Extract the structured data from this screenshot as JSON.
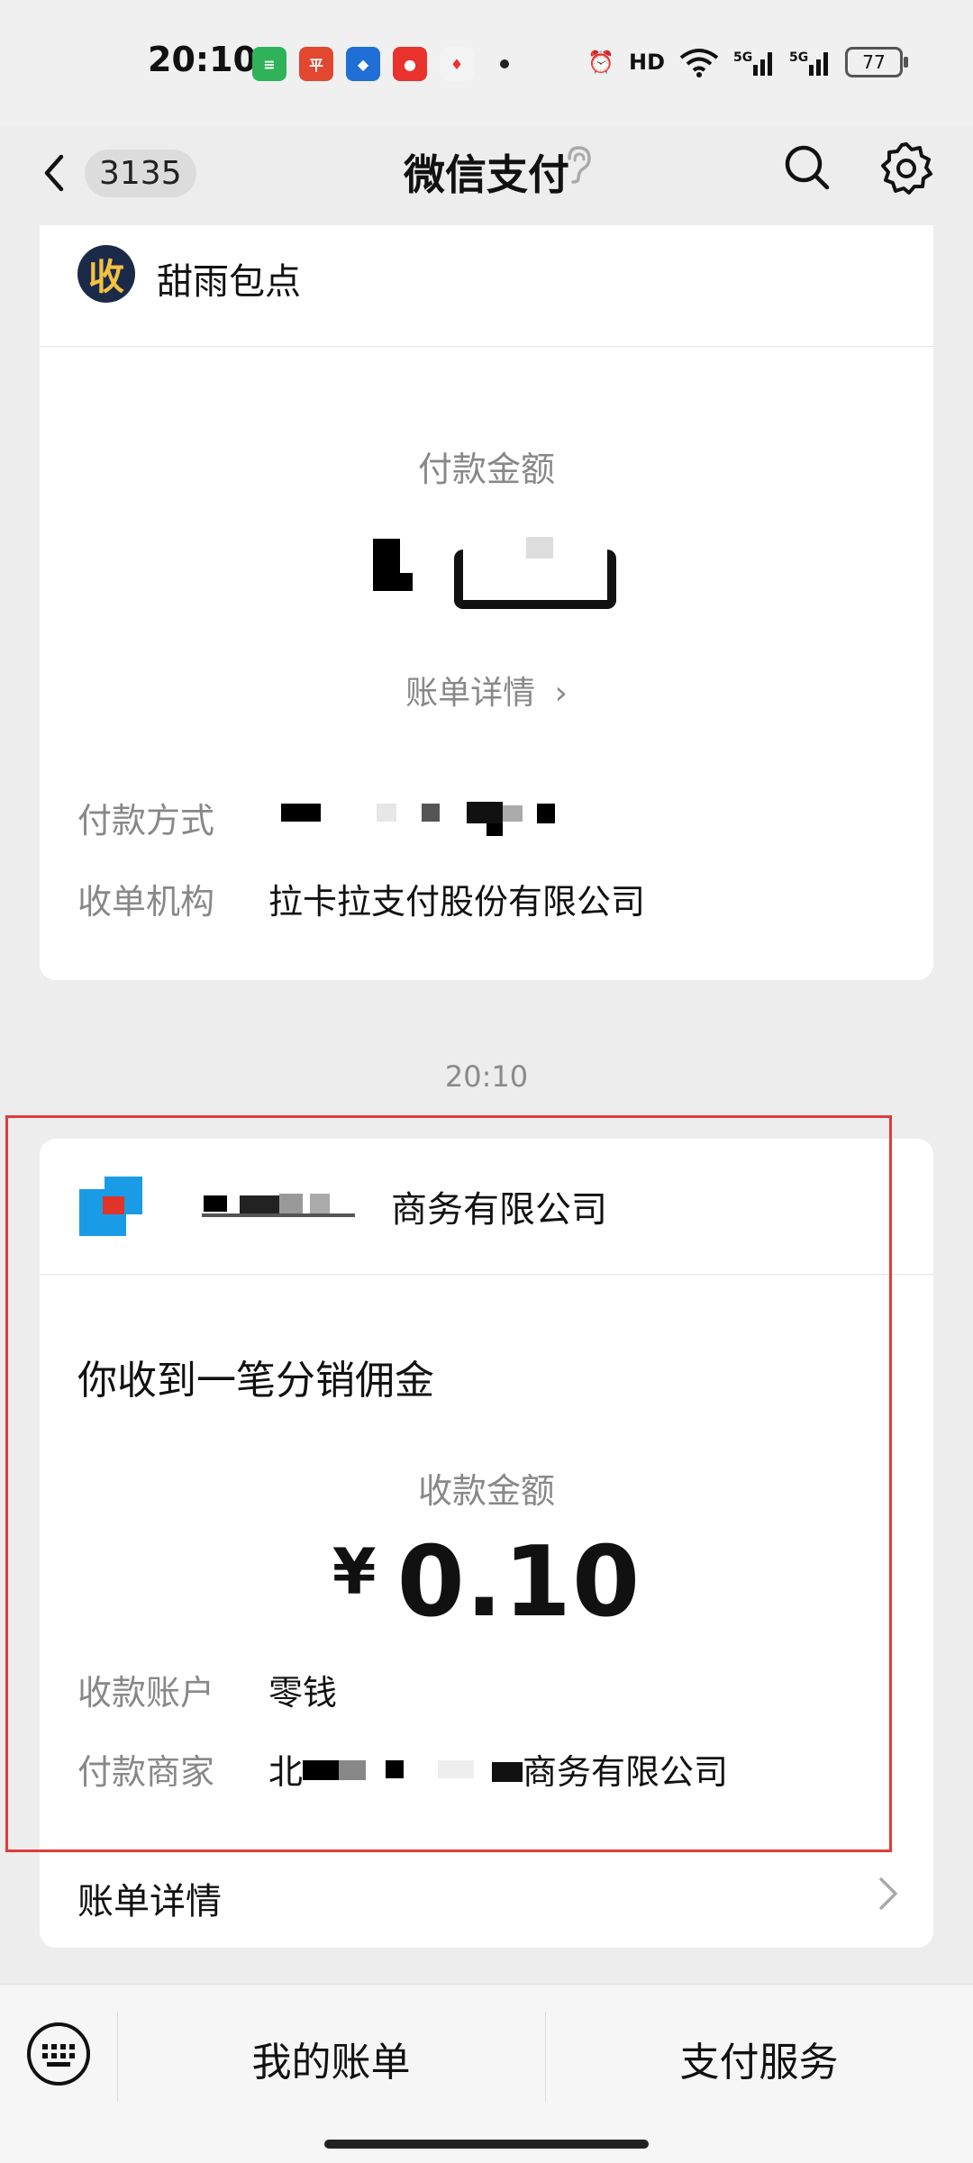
{
  "status_bar": {
    "time": "20:10",
    "battery": "77"
  },
  "nav": {
    "badge_count": "3135",
    "title": "微信支付"
  },
  "card1": {
    "merchant": "甜雨包点",
    "logo_char": "收",
    "amount_label": "付款金额",
    "bill_detail": "账单详情",
    "rows": [
      {
        "key": "付款方式",
        "value": ""
      },
      {
        "key": "收单机构",
        "value": "拉卡拉支付股份有限公司"
      }
    ]
  },
  "timestamp": "20:10",
  "card2": {
    "merchant_suffix": "商务有限公司",
    "notice_title": "你收到一笔分销佣金",
    "amount_label": "收款金额",
    "currency": "¥",
    "amount": "0.10",
    "rows": [
      {
        "key": "收款账户",
        "value": "零钱"
      },
      {
        "key": "付款商家",
        "value_prefix": "北",
        "value_suffix": "商务有限公司"
      }
    ],
    "footer": "账单详情"
  },
  "bottom_bar": {
    "my_bills": "我的账单",
    "pay_services": "支付服务"
  }
}
